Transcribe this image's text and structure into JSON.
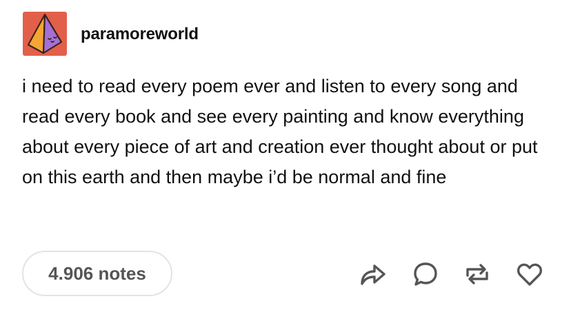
{
  "post": {
    "username": "paramoreworld",
    "avatar_icon": "pyramid-face-icon",
    "avatar_colors": {
      "background": "#e2604a",
      "left_face": "#f6a533",
      "right_face": "#a56fd6",
      "outline": "#3a2418"
    },
    "body": "i need to read every poem ever and listen to every song and read every book and see every painting and know everything about every piece of art and creation ever thought about or put on this earth and then maybe i’d be normal and fine",
    "notes_label": "4.906 notes"
  },
  "actions": [
    {
      "name": "share",
      "icon": "share-arrow-icon"
    },
    {
      "name": "reply",
      "icon": "speech-bubble-icon"
    },
    {
      "name": "reblog",
      "icon": "reblog-icon"
    },
    {
      "name": "like",
      "icon": "heart-icon"
    }
  ],
  "colors": {
    "text": "#111111",
    "muted": "#555555",
    "pill_border": "#e3e3e3",
    "icon": "#555555"
  }
}
